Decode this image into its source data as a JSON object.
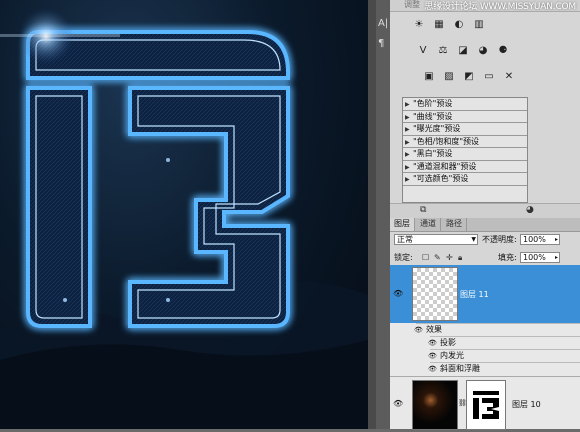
{
  "watermark": "思缘设计论坛  WWW.MISSYUAN.COM",
  "adjustments_header_hint": "调整",
  "toolstrip": {
    "top_glyph": "A|",
    "bottom_glyph": "¶"
  },
  "adjustment_icons_row1": [
    "brightness-icon",
    "levels-icon",
    "curves-icon",
    "exposure-icon"
  ],
  "adjustment_icons_row2": [
    "vibrance-icon",
    "hue-icon",
    "color-balance-icon",
    "bw-icon",
    "photo-filter-icon",
    "channel-mixer-icon"
  ],
  "adjustment_icons_row3": [
    "invert-icon",
    "posterize-icon",
    "threshold-icon",
    "gradient-map-icon",
    "selective-color-icon"
  ],
  "presets": [
    "\"色阶\"预设",
    "\"曲线\"预设",
    "\"曝光度\"预设",
    "\"色相/饱和度\"预设",
    "\"黑白\"预设",
    "\"通道混和器\"预设",
    "\"可选颜色\"预设"
  ],
  "layers_panel": {
    "tabs": [
      "图层",
      "通道",
      "路径"
    ],
    "active_tab": "图层",
    "blend_mode": "正常",
    "opacity_label": "不透明度:",
    "opacity_value": "100%",
    "lock_label": "锁定:",
    "fill_label": "填充:",
    "fill_value": "100%",
    "layers": [
      {
        "name": "图层 11",
        "selected": true,
        "effects_label": "效果",
        "effects": [
          "投影",
          "内发光",
          "斜面和浮雕"
        ]
      },
      {
        "name": "图层 10",
        "selected": false
      }
    ]
  },
  "colors": {
    "selected_layer": "#3a8fd6",
    "neon": "#4aa8ff",
    "canvas_dark": "#07111d"
  }
}
